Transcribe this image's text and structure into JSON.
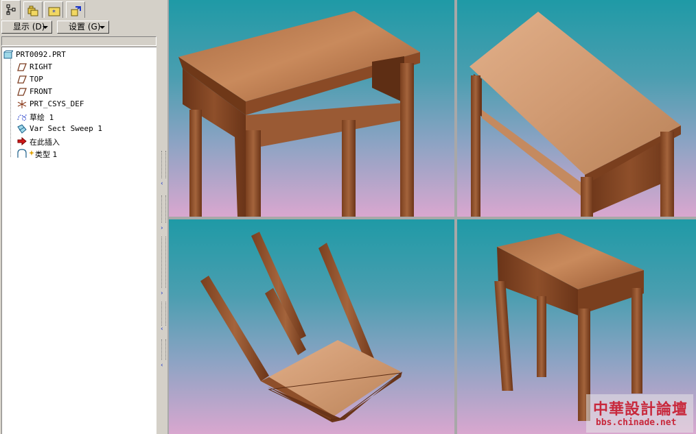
{
  "navigator": {
    "tabs": [
      {
        "icon": "model-tree-icon"
      },
      {
        "icon": "folder-browser-icon"
      },
      {
        "icon": "favorites-icon"
      },
      {
        "icon": "connections-icon"
      }
    ],
    "toolbar": {
      "show_label": "显示 (D)",
      "settings_label": "设置 (G)"
    },
    "tree": [
      {
        "label": "PRT0092.PRT",
        "icon": "part-icon"
      },
      {
        "label": "RIGHT",
        "icon": "datum-plane-icon"
      },
      {
        "label": "TOP",
        "icon": "datum-plane-icon"
      },
      {
        "label": "FRONT",
        "icon": "datum-plane-icon"
      },
      {
        "label": "PRT_CSYS_DEF",
        "icon": "coordinate-system-icon"
      },
      {
        "label": "草绘 1",
        "icon": "sketch-icon"
      },
      {
        "label": "Var Sect Sweep 1",
        "icon": "sweep-icon"
      },
      {
        "label": "在此插入",
        "icon": "insert-here-arrow-icon"
      },
      {
        "label": "类型 1",
        "icon": "feature-type-icon"
      }
    ]
  },
  "viewports": [
    {
      "name": "viewport-top-left",
      "content": "table-model"
    },
    {
      "name": "viewport-top-right",
      "content": "table-model"
    },
    {
      "name": "viewport-bottom-left",
      "content": "table-model"
    },
    {
      "name": "viewport-bottom-right",
      "content": "table-model"
    }
  ],
  "watermark": {
    "title": "中華設計論壇",
    "url": "bbs.chinade.net"
  },
  "colors": {
    "background_top": "#1f9aa6",
    "background_bottom": "#d9a7cf",
    "wood_dark": "#7a3f1e",
    "wood_light": "#c98a5c",
    "panel": "#d4d0c8"
  }
}
